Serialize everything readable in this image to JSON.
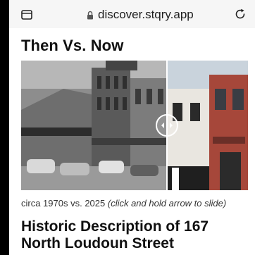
{
  "browser": {
    "url": "discover.stqry.app"
  },
  "page": {
    "title": "Then Vs. Now",
    "comparison": {
      "before_label": "circa 1970s",
      "after_label": "2025"
    },
    "caption_main": "circa 1970s vs. 2025",
    "caption_hint": "(click and hold arrow to slide)",
    "heading": "Historic Description of 167 North Loudoun Street"
  }
}
